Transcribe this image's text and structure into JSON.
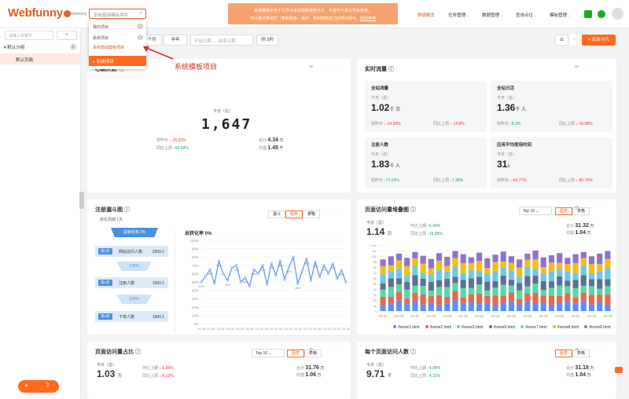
{
  "header": {
    "logo_text": "Webfunny",
    "logo_sub": "© Webfunny",
    "project_placeholder": "系统基础模板项目",
    "notice_line1": "系统模板仅用于引导大家创建和使用卡片，不能作为真实项目使用。",
    "notice_line2": "可以通过菜单栏「复制看板」操作，复制到您自己的项目即可。",
    "notice_link": "如何使用",
    "nav": [
      {
        "label": "数据概览",
        "active": true
      },
      {
        "label": "任务管理",
        "active": false
      },
      {
        "label": "数据管理",
        "active": false
      },
      {
        "label": "查询点位",
        "active": false
      },
      {
        "label": "模板管理",
        "active": false
      }
    ]
  },
  "dropdown": {
    "my_projects": "我的项目",
    "my_count": "0",
    "system_projects": "系统项目",
    "system_count": "1",
    "selected": "系统基础模板项目",
    "new_project": "新建项目"
  },
  "annotation": "系统模板项目",
  "sidebar": {
    "search_placeholder": "请输入关键字",
    "group": "默认分组",
    "group_count": "1",
    "item": "默认页面",
    "add_icon": "plus-icon",
    "upload_icon": "upload-icon"
  },
  "toolbar": {
    "month": "个月",
    "half_year": "半年",
    "start_date": "开始日期",
    "end_date": "结束日期",
    "cols": "2列",
    "new_card": "新建卡片"
  },
  "heartbeat": {
    "title": "心跳次数",
    "today_label": "今天（总）",
    "value": "1,647",
    "yesterday_label": "较昨日",
    "yesterday_change": "15.02%",
    "lastweek_label": "同比上周",
    "lastweek_change": "60.68%",
    "total_label": "合计",
    "total_value": "4.34",
    "total_unit": "万",
    "avg_label": "均值",
    "avg_value": "1.45",
    "avg_unit": "千"
  },
  "realtime": {
    "title": "实时流量",
    "cards": [
      {
        "title": "全站流量",
        "date": "今天（总）",
        "value": "1.02",
        "unit": "千 次",
        "c1": "14.59%",
        "c1_up": false,
        "c2": "14.8%",
        "c2_up": false
      },
      {
        "title": "全站日活",
        "date": "今天（总）",
        "value": "1.36",
        "unit": "千 人",
        "c1": "8.3%",
        "c1_up": true,
        "c2": "16.08%",
        "c2_up": false
      },
      {
        "title": "注册人数",
        "date": "今天（总）",
        "value": "1.83",
        "unit": "千 人",
        "c1": "71.63%",
        "c1_up": true,
        "c2": "7.38%",
        "c2_up": true
      },
      {
        "title": "应用平均使用时间",
        "date": "今天（总）",
        "value": "31",
        "unit": "s",
        "c1": "64.77%",
        "c1_up": false,
        "c2": "80.76%",
        "c2_up": false
      }
    ],
    "c1_label": "较昨日",
    "c2_label": "同比上周"
  },
  "funnel": {
    "title": "注册漏斗图",
    "period": "转化周期 1天",
    "seg": [
      "漏斗",
      "趋势",
      "表格"
    ],
    "overall": "总转化率 0%",
    "steps": [
      {
        "tag": "第1步",
        "name": "网站访问人数",
        "count": "2000人"
      },
      {
        "tag": "第2步",
        "name": "注册人数",
        "count": "1000人"
      },
      {
        "tag": "第3步",
        "name": "下单人数",
        "count": "1000人"
      }
    ],
    "conv": [
      "100%",
      "100%"
    ],
    "chart_label": "总转化率 0%"
  },
  "stack": {
    "title": "页面访问量堆叠图",
    "top": "Top 10",
    "seg": [
      "图表",
      "表格"
    ],
    "today_label": "今日（总）",
    "value": "1.14",
    "unit": "万",
    "c1_label": "环比上期",
    "c1": "5.49%",
    "c2_label": "同比上周",
    "c2": "16.85%",
    "total_label": "合计",
    "total_value": "31.32",
    "total_unit": "万",
    "avg_label": "均值",
    "avg_value": "1.04",
    "avg_unit": "万"
  },
  "pie": {
    "title": "页面访问量占比",
    "top": "Top 10",
    "seg": [
      "图表",
      "表格"
    ],
    "today_label": "今日（总）",
    "value": "1.03",
    "unit": "万",
    "c1_label": "环比上期",
    "c1": "6.85%",
    "c2_label": "同比上周",
    "c2": "6.12%",
    "total_label": "合计",
    "total_value": "31.76",
    "total_unit": "万",
    "avg_label": "均值",
    "avg_value": "1.06",
    "avg_unit": "万"
  },
  "perpage": {
    "title": "每个页面访问人数",
    "seg": [
      "图表",
      "表格"
    ],
    "today_label": "今日（总）",
    "value": "9.71",
    "unit": "千",
    "c1_label": "环比上期",
    "c1": "4.98%",
    "c2_label": "同比上周",
    "c2": "4.22%",
    "total_label": "合计",
    "total_value": "31.18",
    "total_unit": "万",
    "avg_label": "均值",
    "avg_value": "1.04",
    "avg_unit": "万"
  },
  "chart_data": [
    {
      "type": "line",
      "title": "总转化率 0%",
      "x": [
        "04-08",
        "04-08",
        "04-08",
        "04-08",
        "04-08",
        "04-08",
        "04-18",
        "04-18",
        "04-18",
        "04-18",
        "04-18",
        "04-18",
        "04-18",
        "04-28",
        "04-28",
        "04-28"
      ],
      "series": [
        {
          "values": [
            50,
            57,
            65,
            48,
            75,
            60,
            52,
            67,
            70,
            50,
            55,
            45,
            65,
            60,
            70,
            47,
            72,
            58,
            75,
            53,
            68,
            80,
            48,
            63,
            78,
            52,
            74,
            56,
            70,
            60,
            72,
            54,
            64,
            50
          ]
        }
      ],
      "ylim": [
        0,
        100
      ],
      "yticks": [
        "0%",
        "10%",
        "20%",
        "30%",
        "40%",
        "50%",
        "60%",
        "70%",
        "80%",
        "90%",
        "100%"
      ]
    },
    {
      "type": "bar",
      "title": "页面访问量堆叠图",
      "categories": [
        "03-31",
        "04-02",
        "04-04",
        "04-06",
        "04-08",
        "04-10",
        "04-12",
        "04-14",
        "04-16",
        "04-18",
        "04-20",
        "04-22",
        "04-24",
        "04-26",
        "04-28"
      ],
      "yticks": [
        "0",
        "1k",
        "2k",
        "3k",
        "4k",
        "5k",
        "6k",
        "7k",
        "8k",
        "9k",
        "10k",
        "11k",
        "1.2w"
      ],
      "series": [
        {
          "name": "/home1.html",
          "color": "#5b8ff9"
        },
        {
          "name": "/home2.html",
          "color": "#e8684a"
        },
        {
          "name": "/home3.html",
          "color": "#5ad8a6"
        },
        {
          "name": "/home9.html",
          "color": "#5d7092"
        },
        {
          "name": "/home7.html",
          "color": "#6dc8ec"
        },
        {
          "name": "/home8.html",
          "color": "#f6bd16"
        },
        {
          "name": "/home6.html",
          "color": "#9270ca"
        }
      ]
    }
  ]
}
